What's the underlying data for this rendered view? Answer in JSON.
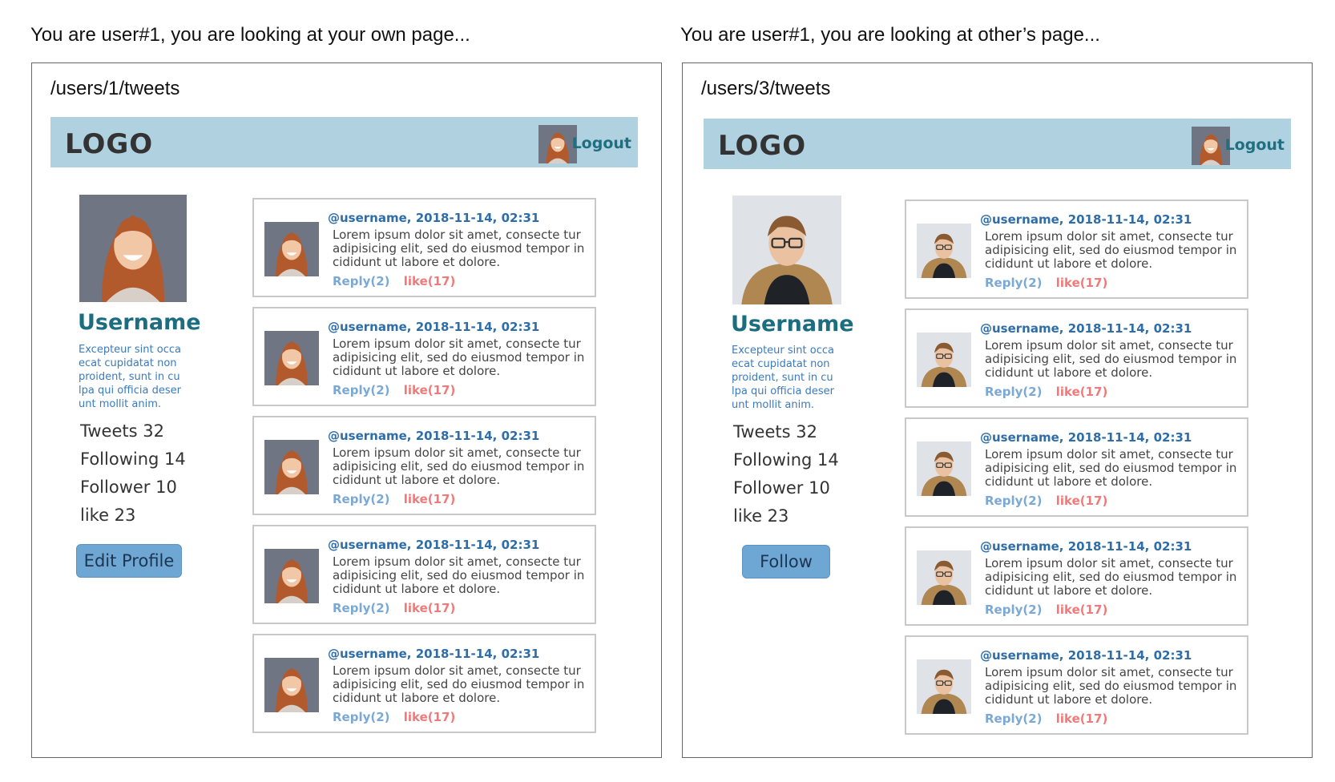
{
  "panels": [
    {
      "caption": "You are user#1, you are looking at your own page...",
      "route": "/users/1/tweets",
      "navbar": {
        "logo": "LOGO",
        "logout": "Logout"
      },
      "profile": {
        "username": "Username",
        "bio": "Excepteur sint occa ecat cupidatat non proident, sunt in cu lpa qui officia deser unt mollit anim.",
        "stats": [
          "Tweets 32",
          "Following 14",
          "Follower 10",
          "like 23"
        ],
        "button": "Edit Profile"
      },
      "tweets": [
        {
          "meta": "@username, 2018-11-14, 02:31",
          "body": "Lorem ipsum dolor sit amet, consecte tur adipisicing elit, sed do eiusmod tempor in cididunt ut labore et dolore.",
          "reply": "Reply(2)",
          "like": "like(17)"
        },
        {
          "meta": "@username, 2018-11-14, 02:31",
          "body": "Lorem ipsum dolor sit amet, consecte tur adipisicing elit, sed do eiusmod tempor in cididunt ut labore et dolore.",
          "reply": "Reply(2)",
          "like": "like(17)"
        },
        {
          "meta": "@username, 2018-11-14, 02:31",
          "body": "Lorem ipsum dolor sit amet, consecte tur adipisicing elit, sed do eiusmod tempor in cididunt ut labore et dolore.",
          "reply": "Reply(2)",
          "like": "like(17)"
        },
        {
          "meta": "@username, 2018-11-14, 02:31",
          "body": "Lorem ipsum dolor sit amet, consecte tur adipisicing elit, sed do eiusmod tempor in cididunt ut labore et dolore.",
          "reply": "Reply(2)",
          "like": "like(17)"
        },
        {
          "meta": "@username, 2018-11-14, 02:31",
          "body": "Lorem ipsum dolor sit amet, consecte tur adipisicing elit, sed do eiusmod tempor in cididunt ut labore et dolore.",
          "reply": "Reply(2)",
          "like": "like(17)"
        }
      ]
    },
    {
      "caption": "You are user#1, you are looking at other’s page...",
      "route": "/users/3/tweets",
      "navbar": {
        "logo": "LOGO",
        "logout": "Logout"
      },
      "profile": {
        "username": "Username",
        "bio": "Excepteur sint occa ecat cupidatat non proident, sunt in cu lpa qui officia deser unt mollit anim.",
        "stats": [
          "Tweets 32",
          "Following 14",
          "Follower 10",
          "like 23"
        ],
        "button": "Follow"
      },
      "tweets": [
        {
          "meta": "@username, 2018-11-14, 02:31",
          "body": "Lorem ipsum dolor sit amet, consecte tur adipisicing elit, sed do eiusmod tempor in cididunt ut labore et dolore.",
          "reply": "Reply(2)",
          "like": "like(17)"
        },
        {
          "meta": "@username, 2018-11-14, 02:31",
          "body": "Lorem ipsum dolor sit amet, consecte tur adipisicing elit, sed do eiusmod tempor in cididunt ut labore et dolore.",
          "reply": "Reply(2)",
          "like": "like(17)"
        },
        {
          "meta": "@username, 2018-11-14, 02:31",
          "body": "Lorem ipsum dolor sit amet, consecte tur adipisicing elit, sed do eiusmod tempor in cididunt ut labore et dolore.",
          "reply": "Reply(2)",
          "like": "like(17)"
        },
        {
          "meta": "@username, 2018-11-14, 02:31",
          "body": "Lorem ipsum dolor sit amet, consecte tur adipisicing elit, sed do eiusmod tempor in cididunt ut labore et dolore.",
          "reply": "Reply(2)",
          "like": "like(17)"
        },
        {
          "meta": "@username, 2018-11-14, 02:31",
          "body": "Lorem ipsum dolor sit amet, consecte tur adipisicing elit, sed do eiusmod tempor in cididunt ut labore et dolore.",
          "reply": "Reply(2)",
          "like": "like(17)"
        }
      ]
    }
  ],
  "colors": {
    "navbar_bg": "#b0d1e0",
    "username": "#1c6d7f",
    "bio": "#3a7abf",
    "tweet_meta": "#2e6da8",
    "reply": "#7aa9d6",
    "like": "#f07a7a",
    "button_bg": "#6ea6d4"
  },
  "icons": {
    "own_avatar": "woman-avatar-icon",
    "other_avatar": "man-avatar-icon"
  }
}
